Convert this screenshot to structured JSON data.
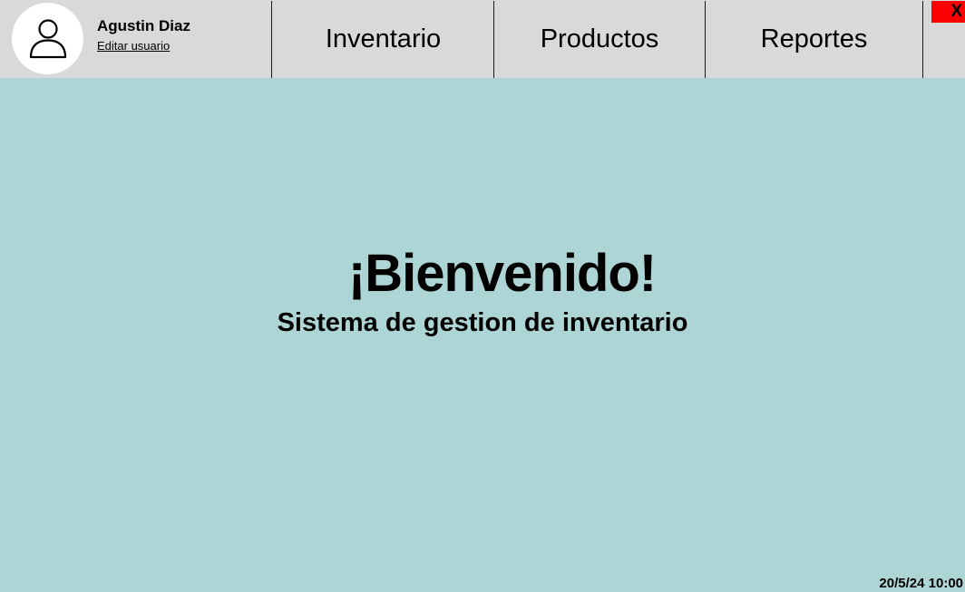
{
  "user": {
    "name": "Agustin Diaz",
    "edit_label": "Editar usuario"
  },
  "nav": {
    "tabs": [
      {
        "label": "Inventario"
      },
      {
        "label": "Productos"
      },
      {
        "label": "Reportes"
      }
    ],
    "close_label": "X"
  },
  "main": {
    "title": "¡Bienvenido!",
    "subtitle": "Sistema de gestion de inventario"
  },
  "status": {
    "datetime": "20/5/24 10:00"
  },
  "colors": {
    "background": "#aed5d5",
    "topbar": "#d9d9d9",
    "close_button": "#ff0000"
  },
  "icons": {
    "avatar": "user-icon"
  }
}
